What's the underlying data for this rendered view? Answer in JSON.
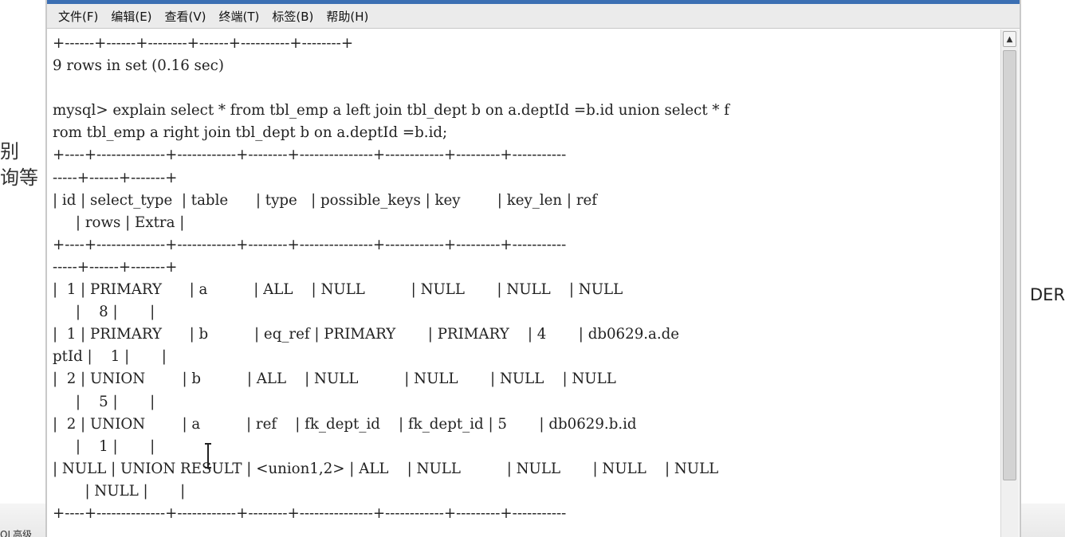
{
  "background": {
    "left_fragment_1": "别",
    "left_fragment_2": "询等",
    "right_fragment": "DER",
    "bottom_left_fragment": "QL高级"
  },
  "menubar": {
    "items": [
      {
        "label": "文件(F)"
      },
      {
        "label": "编辑(E)"
      },
      {
        "label": "查看(V)"
      },
      {
        "label": "终端(T)"
      },
      {
        "label": "标签(B)"
      },
      {
        "label": "帮助(H)"
      }
    ]
  },
  "terminal": {
    "lines": [
      "+------+------+--------+------+----------+--------+",
      "9 rows in set (0.16 sec)",
      "",
      "mysql> explain select * from tbl_emp a left join tbl_dept b on a.deptId =b.id union select * f",
      "rom tbl_emp a right join tbl_dept b on a.deptId =b.id;",
      "+----+--------------+------------+--------+---------------+------------+---------+-----------",
      "-----+------+-------+",
      "| id | select_type  | table      | type   | possible_keys | key        | key_len | ref",
      "     | rows | Extra |",
      "+----+--------------+------------+--------+---------------+------------+---------+-----------",
      "-----+------+-------+",
      "|  1 | PRIMARY      | a          | ALL    | NULL          | NULL       | NULL    | NULL",
      "     |    8 |       |",
      "|  1 | PRIMARY      | b          | eq_ref | PRIMARY       | PRIMARY    | 4       | db0629.a.de",
      "ptId |    1 |       |",
      "|  2 | UNION        | b          | ALL    | NULL          | NULL       | NULL    | NULL",
      "     |    5 |       |",
      "|  2 | UNION        | a          | ref    | fk_dept_id    | fk_dept_id | 5       | db0629.b.id",
      "     |    1 |       |",
      "| NULL | UNION RESULT | <union1,2> | ALL    | NULL          | NULL       | NULL    | NULL",
      "       | NULL |       |",
      "+----+--------------+------------+--------+---------------+------------+---------+-----------"
    ]
  },
  "colors": {
    "menubar_bg": "#ebebeb",
    "terminal_bg": "#ffffff",
    "text": "#222222",
    "title_strip": "#3b6fb3"
  }
}
